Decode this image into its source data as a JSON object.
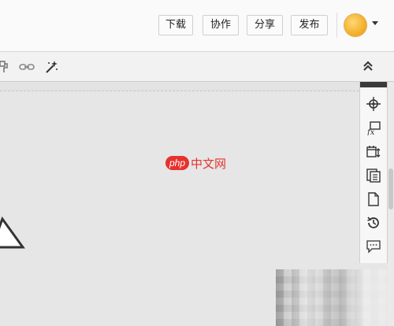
{
  "header": {
    "buttons": [
      {
        "id": "download",
        "label": "下载"
      },
      {
        "id": "collaborate",
        "label": "协作"
      },
      {
        "id": "share",
        "label": "分享"
      },
      {
        "id": "publish",
        "label": "发布"
      }
    ]
  },
  "toolbar": {
    "icons": [
      "format-painter-icon",
      "link-icon",
      "magic-wand-icon",
      "collapse-icon"
    ]
  },
  "sidebar": {
    "icons": [
      "target-icon",
      "formula-icon",
      "calendar-icon",
      "page-copy-icon",
      "blank-page-icon",
      "history-icon",
      "comment-icon"
    ]
  },
  "watermark": {
    "logo": "php",
    "text": "中文网"
  },
  "colors": {
    "accent": "#e6322e",
    "avatar": "#f4b12d",
    "background": "#e6e6e6"
  }
}
